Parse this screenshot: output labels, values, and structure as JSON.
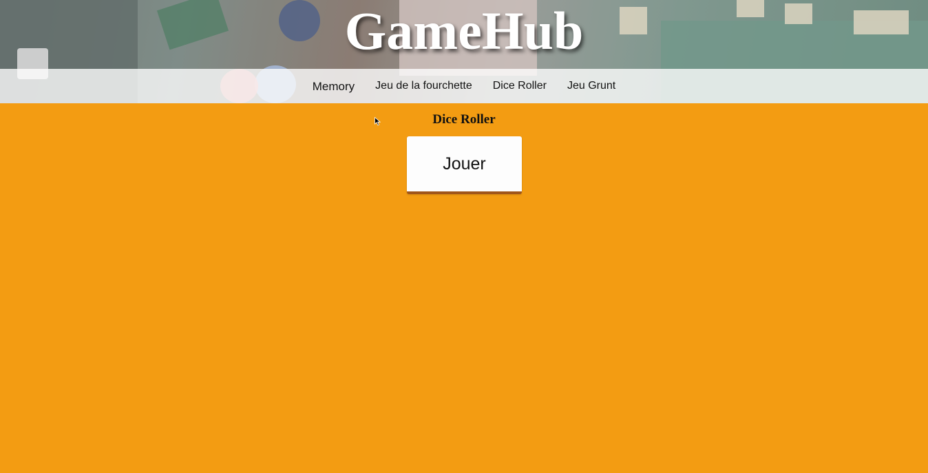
{
  "header": {
    "title": "GameHub",
    "background_description_icon": "board-games-background"
  },
  "nav": {
    "items": [
      {
        "label": "Memory"
      },
      {
        "label": "Jeu de la fourchette"
      },
      {
        "label": "Dice Roller"
      },
      {
        "label": "Jeu Grunt"
      }
    ]
  },
  "main": {
    "section_title": "Dice Roller",
    "play_button_label": "Jouer"
  },
  "colors": {
    "page_background": "#f39c12",
    "button_shadow": "#a0561a"
  }
}
